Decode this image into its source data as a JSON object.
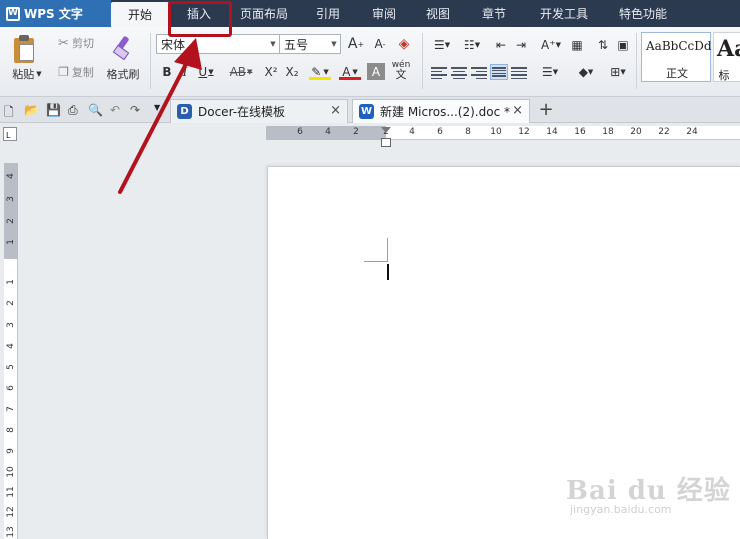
{
  "app": {
    "name": "WPS 文字",
    "logo_glyph": "W"
  },
  "menu": {
    "items": [
      {
        "label": "开始",
        "active": true
      },
      {
        "label": "插入",
        "active": false
      },
      {
        "label": "页面布局",
        "active": false
      },
      {
        "label": "引用",
        "active": false
      },
      {
        "label": "审阅",
        "active": false
      },
      {
        "label": "视图",
        "active": false
      },
      {
        "label": "章节",
        "active": false
      },
      {
        "label": "开发工具",
        "active": false
      },
      {
        "label": "特色功能",
        "active": false
      }
    ]
  },
  "ribbon": {
    "clipboard": {
      "paste_label": "粘贴",
      "cut_label": "剪切",
      "copy_label": "复制",
      "format_painter_label": "格式刷"
    },
    "font": {
      "font_name": "宋体",
      "font_size": "五号",
      "bold": "B",
      "italic": "I",
      "underline": "U",
      "strike": "AB",
      "superscript": "X²",
      "subscript": "X₂",
      "font_color_letter": "A",
      "char_shading_letter": "A",
      "phonetic": "wén",
      "grow": "A",
      "shrink": "A"
    },
    "styles": {
      "normal_sample": "AaBbCcDd",
      "normal_name": "正文",
      "heading_sample": "Aa",
      "heading_name": "标"
    },
    "colors": {
      "highlight": "#f5e400",
      "font_color": "#d61f1f",
      "shading": "#7f7f7f"
    }
  },
  "tabs": [
    {
      "title": "Docer-在线模板",
      "icon": "docer-icon",
      "icon_letter": "D"
    },
    {
      "title": "新建 Micros...(2).doc *",
      "icon": "word-doc-icon",
      "icon_letter": "W"
    }
  ],
  "tab_close_glyph": "×",
  "new_tab_glyph": "+",
  "ruler": {
    "corner_glyph": "L",
    "horizontal_labels": [
      "6",
      "4",
      "2",
      "2",
      "4",
      "6",
      "8",
      "10",
      "12",
      "14",
      "16",
      "18",
      "20",
      "22",
      "24"
    ],
    "vertical_labels": [
      "4",
      "3",
      "2",
      "1",
      "1",
      "2",
      "3",
      "4",
      "5",
      "6",
      "7",
      "8",
      "9",
      "10",
      "11",
      "12",
      "13"
    ]
  },
  "watermark": {
    "brand": "Bai du 经验",
    "url": "jingyan.baidu.com"
  },
  "annotation": {
    "color": "#b3121d"
  }
}
